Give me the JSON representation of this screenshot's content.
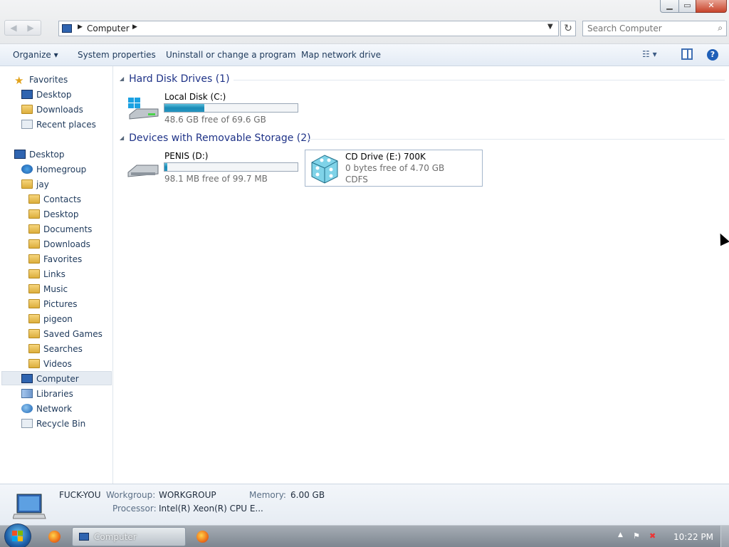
{
  "window": {
    "minimize": "▁",
    "maximize": "▭",
    "close": "✕"
  },
  "address": {
    "crumb": "Computer",
    "search_placeholder": "Search Computer"
  },
  "commands": {
    "organize": "Organize ▾",
    "system_properties": "System properties",
    "uninstall": "Uninstall or change a program",
    "map_drive": "Map network drive"
  },
  "nav": {
    "favorites": "Favorites",
    "fav_items": [
      "Desktop",
      "Downloads",
      "Recent places"
    ],
    "desktop": "Desktop",
    "homegroup": "Homegroup",
    "user": "jay",
    "user_items": [
      "Contacts",
      "Desktop",
      "Documents",
      "Downloads",
      "Favorites",
      "Links",
      "Music",
      "Pictures",
      "pigeon",
      "Saved Games",
      "Searches",
      "Videos"
    ],
    "computer": "Computer",
    "libraries": "Libraries",
    "network": "Network",
    "recycle_bin": "Recycle Bin"
  },
  "groups": {
    "hdd": "Hard Disk Drives (1)",
    "removable": "Devices with Removable Storage (2)"
  },
  "drives": {
    "c": {
      "name": "Local Disk (C:)",
      "free": "48.6 GB free of 69.6 GB",
      "used_fraction": 0.3
    },
    "d": {
      "name": "PENIS (D:)",
      "free": "98.1 MB free of 99.7 MB",
      "used_fraction": 0.02
    },
    "e": {
      "name": "CD Drive (E:) 700K",
      "free": "0 bytes free of 4.70 GB",
      "fs": "CDFS"
    }
  },
  "details": {
    "computer_name": "FUCK-YOU",
    "workgroup_label": "Workgroup:",
    "workgroup": "WORKGROUP",
    "memory_label": "Memory:",
    "memory": "6.00 GB",
    "processor_label": "Processor:",
    "processor": "Intel(R) Xeon(R) CPU E..."
  },
  "taskbar": {
    "computer": "Computer",
    "clock": "10:22 PM"
  },
  "colors": {
    "accent": "#1e3287",
    "bar_fill": "#1a8ab6"
  }
}
